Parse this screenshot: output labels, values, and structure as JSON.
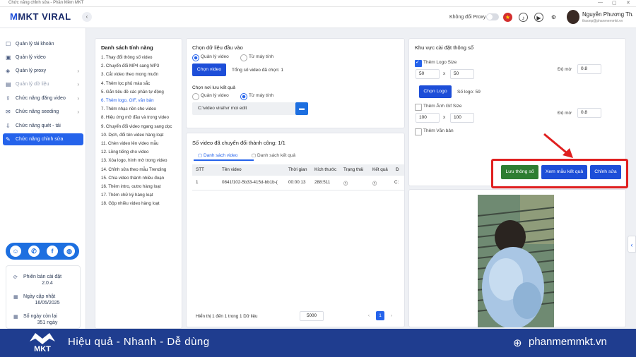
{
  "window": {
    "title": "Chức năng chỉnh sửa - Phần Mềm MKT",
    "controls": [
      "—",
      "▢",
      "✕"
    ]
  },
  "brand": {
    "logo_prefix": "M",
    "logo_text": "MKT VIRAL"
  },
  "header": {
    "proxy_label": "Không đổi Proxy",
    "user_name": "Nguyễn Phương Th...",
    "user_email": "thaonp@phanmemmkt.vn",
    "collapse_icon": "chevron-left-icon"
  },
  "sidebar": {
    "items": [
      {
        "label": "Quản lý tài khoản",
        "icon": "user-icon"
      },
      {
        "label": "Quản lý video",
        "icon": "video-icon"
      },
      {
        "label": "Quản lý proxy",
        "icon": "shield-icon",
        "chevron": "›"
      },
      {
        "label": "Quản lý dữ liệu",
        "icon": "database-icon",
        "chevron": "›"
      },
      {
        "label": "Chức năng đăng video",
        "icon": "upload-icon",
        "chevron": "›"
      },
      {
        "label": "Chức năng seeding",
        "icon": "chat-icon",
        "chevron": "›"
      },
      {
        "label": "Chức năng quét - tải",
        "icon": "download-icon"
      },
      {
        "label": "Chức năng chỉnh sửa",
        "icon": "edit-icon"
      }
    ],
    "info": [
      {
        "label": "Phiên bản cài đặt",
        "value": "2.0.4"
      },
      {
        "label": "Ngày cập nhật",
        "value": "16/05/2025"
      },
      {
        "label": "Số ngày còn lại",
        "value": "351 ngày"
      }
    ]
  },
  "features": {
    "title": "Danh sách tính năng",
    "selected_index": 5,
    "items": [
      "1. Thay đổi thông số video",
      "2. Chuyển đổi MP4 sang MP3",
      "3. Cắt video theo mong muốn",
      "4. Thêm lọc phủ màu sắc",
      "5. Gắn tiêu đề các phần tự động",
      "6. Thêm logo, GIF, văn bản",
      "7. Thêm nhạc nền cho video",
      "8. Hiệu ứng mở đầu và trong video",
      "9. Chuyển đổi video ngang sang dọc",
      "10. Dịch, đổi tên video hàng loạt",
      "11. Chèn video lên video mẫu",
      "12. Lồng tiếng cho video",
      "13. Xóa logo, hình mờ trong video",
      "14. Chỉnh sửa theo mẫu Trending",
      "15. Chia video thành nhiều đoạn",
      "16. Thêm intro, outro hàng loạt",
      "17. Thêm chữ ký hàng loạt",
      "18. Gộp nhiều video hàng loạt"
    ]
  },
  "input": {
    "title": "Chọn dữ liệu đầu vào",
    "option_video": "Quản lý video",
    "option_computer": "Từ máy tính",
    "choose_button": "Chọn video",
    "count_text": "Tổng số video đã chọn: 1",
    "save_title": "Chọn nơi lưu kết quả",
    "save_video": "Quản lý video",
    "save_computer": "Từ máy tính",
    "save_path": "C:\\video viral\\vr moi edit"
  },
  "results": {
    "title": "Số video đã chuyển đổi thành công: 1/1",
    "tab_list": "Danh sách video",
    "tab_result": "Danh sách kết quả",
    "columns": [
      "STT",
      "Tên video",
      "Thời gian",
      "Kích thước",
      "Trạng thái",
      "Kết quả",
      "Đ"
    ],
    "rows": [
      [
        "1",
        "0841f102-5b33-415d-bb1b-(",
        "00:00:13",
        "288:511",
        "⓵",
        "⓵",
        "C:"
      ]
    ],
    "footer_text": "Hiển thị 1 đến 1 trong 1 Dữ liệu",
    "page_size": "5000",
    "prev": "‹",
    "page": "1",
    "next": "›"
  },
  "settings": {
    "title": "Khu vực cài đặt thông số",
    "logo_size_label": "Thêm Logo Size",
    "logo_w": "50",
    "logo_h": "50",
    "opacity_label": "Độ mờ",
    "logo_opacity": "0.8",
    "choose_logo": "Chọn Logo",
    "logo_count": "Số logo: 59",
    "gif_label": "Thêm Ảnh Gif Size",
    "gif_w": "100",
    "gif_h": "100",
    "gif_opacity": "0.8",
    "text_label": "Thêm Văn bản",
    "times": "x"
  },
  "actions": {
    "save_params": "Lưu thông số",
    "view_sample": "Xem mẫu kết quả",
    "edit": "Chỉnh sửa"
  },
  "footer": {
    "logo_text": "MKT",
    "slogan": "Hiệu quả - Nhanh - Dễ dùng",
    "website": "phanmemmkt.vn"
  },
  "colors": {
    "primary": "#1d4ed8",
    "accent_green": "#2e7d32",
    "highlight_red": "#e02020",
    "footer_bg": "#1f3d8f"
  }
}
